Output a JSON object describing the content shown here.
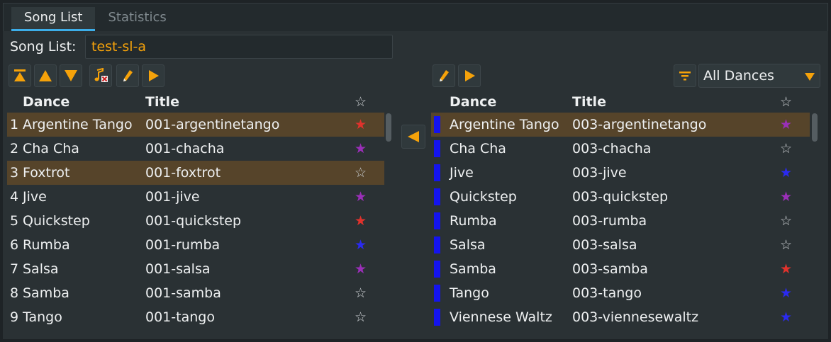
{
  "tabs": [
    {
      "label": "Song List",
      "active": true
    },
    {
      "label": "Statistics",
      "active": false
    }
  ],
  "song_list": {
    "label": "Song List:",
    "value": "test-sl-a"
  },
  "colors": {
    "accent": "#f5a20a",
    "highlight": "#56442a",
    "tab_indicator": "#3daee9",
    "marker": "#1414ee",
    "star_red": "#e0322c",
    "star_purple": "#9a2fb8",
    "star_blue": "#2a2af0",
    "star_empty": "#c8cccf"
  },
  "left_toolbar": [
    "move-to-top-icon",
    "move-up-icon",
    "move-down-icon",
    "remove-song-icon",
    "edit-icon",
    "play-icon"
  ],
  "right_toolbar": [
    "edit-icon",
    "play-icon"
  ],
  "filter": {
    "icon": "filter-icon",
    "selected": "All Dances"
  },
  "left_table": {
    "headers": {
      "dance": "Dance",
      "title": "Title"
    },
    "rows": [
      {
        "index": "1",
        "dance": "Argentine Tango",
        "title": "001-argentinetango",
        "star": "red",
        "highlighted": true
      },
      {
        "index": "2",
        "dance": "Cha Cha",
        "title": "001-chacha",
        "star": "purple",
        "highlighted": false
      },
      {
        "index": "3",
        "dance": "Foxtrot",
        "title": "001-foxtrot",
        "star": "empty",
        "highlighted": true
      },
      {
        "index": "4",
        "dance": "Jive",
        "title": "001-jive",
        "star": "purple",
        "highlighted": false
      },
      {
        "index": "5",
        "dance": "Quickstep",
        "title": "001-quickstep",
        "star": "red",
        "highlighted": false
      },
      {
        "index": "6",
        "dance": "Rumba",
        "title": "001-rumba",
        "star": "blue",
        "highlighted": false
      },
      {
        "index": "7",
        "dance": "Salsa",
        "title": "001-salsa",
        "star": "purple",
        "highlighted": false
      },
      {
        "index": "8",
        "dance": "Samba",
        "title": "001-samba",
        "star": "empty",
        "highlighted": false
      },
      {
        "index": "9",
        "dance": "Tango",
        "title": "001-tango",
        "star": "empty",
        "highlighted": false
      }
    ]
  },
  "right_table": {
    "headers": {
      "dance": "Dance",
      "title": "Title"
    },
    "rows": [
      {
        "dance": "Argentine Tango",
        "title": "003-argentinetango",
        "star": "purple",
        "highlighted": true
      },
      {
        "dance": "Cha Cha",
        "title": "003-chacha",
        "star": "empty",
        "highlighted": false
      },
      {
        "dance": "Jive",
        "title": "003-jive",
        "star": "blue",
        "highlighted": false
      },
      {
        "dance": "Quickstep",
        "title": "003-quickstep",
        "star": "purple",
        "highlighted": false
      },
      {
        "dance": "Rumba",
        "title": "003-rumba",
        "star": "empty",
        "highlighted": false
      },
      {
        "dance": "Salsa",
        "title": "003-salsa",
        "star": "empty",
        "highlighted": false
      },
      {
        "dance": "Samba",
        "title": "003-samba",
        "star": "red",
        "highlighted": false
      },
      {
        "dance": "Tango",
        "title": "003-tango",
        "star": "blue",
        "highlighted": false
      },
      {
        "dance": "Viennese Waltz",
        "title": "003-viennesewaltz",
        "star": "blue",
        "highlighted": false
      }
    ]
  }
}
